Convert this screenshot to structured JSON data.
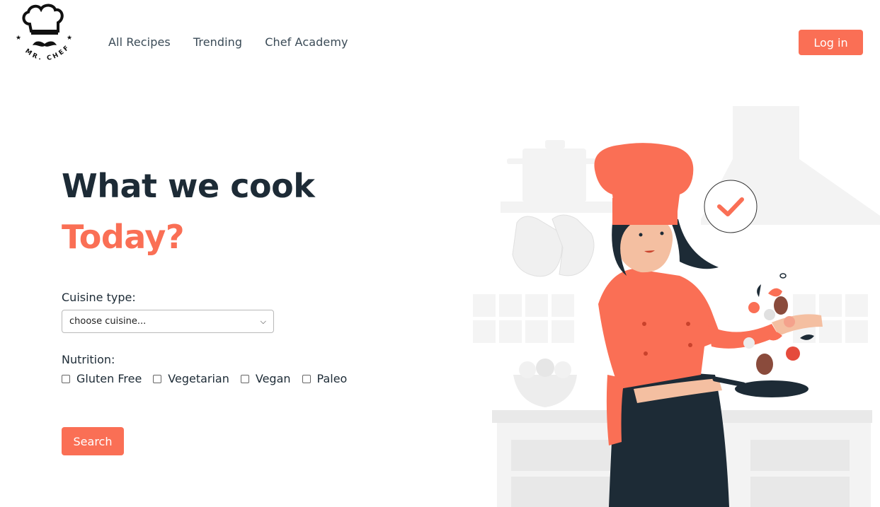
{
  "logo": {
    "text": "MR. CHEF"
  },
  "nav": {
    "items": [
      "All Recipes",
      "Trending",
      "Chef Academy"
    ]
  },
  "header": {
    "login_label": "Log in"
  },
  "hero": {
    "title_line1": "What we cook",
    "title_line2": "Today?"
  },
  "form": {
    "cuisine_label": "Cuisine type:",
    "cuisine_value": "choose cuisine...",
    "nutrition_label": "Nutrition:",
    "nutrition_options": [
      "Gluten Free",
      "Vegetarian",
      "Vegan",
      "Paleo"
    ],
    "search_label": "Search"
  },
  "colors": {
    "accent": "#fa6f55",
    "dark": "#1d2b36"
  }
}
